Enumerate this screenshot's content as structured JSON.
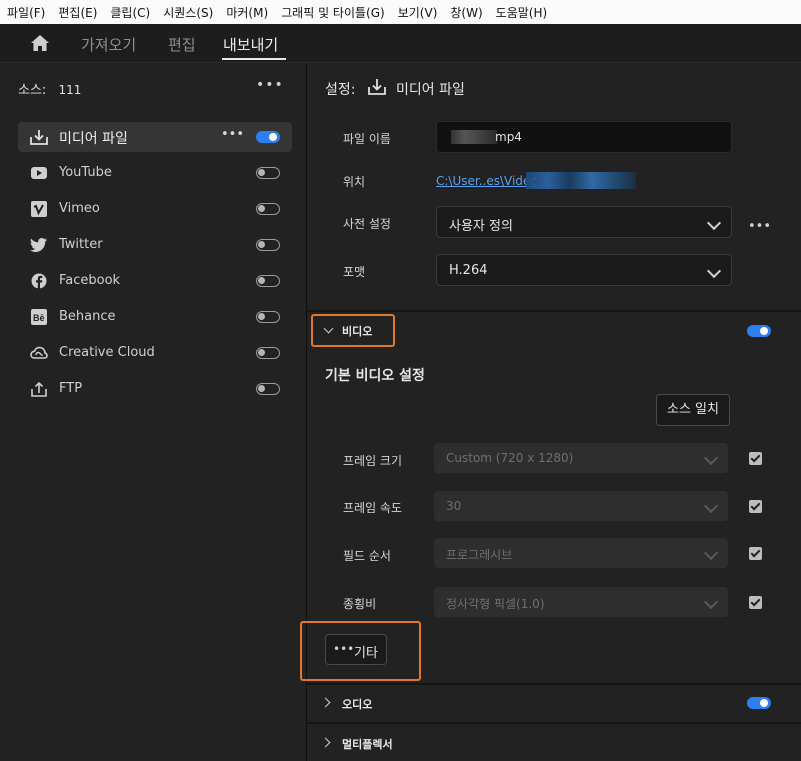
{
  "menubar": [
    "파일(F)",
    "편집(E)",
    "클립(C)",
    "시퀀스(S)",
    "마커(M)",
    "그래픽 및 타이틀(G)",
    "보기(V)",
    "창(W)",
    "도움말(H)"
  ],
  "tabs": {
    "import": "가져오기",
    "edit": "편집",
    "export": "내보내기"
  },
  "source": {
    "label": "소스:",
    "name": "111",
    "more": "•••"
  },
  "destinations": [
    {
      "label": "미디어 파일",
      "icon": "export-file-icon",
      "enabled": true,
      "selected": true,
      "more": "•••"
    },
    {
      "label": "YouTube",
      "icon": "youtube-icon",
      "enabled": false
    },
    {
      "label": "Vimeo",
      "icon": "vimeo-icon",
      "enabled": false
    },
    {
      "label": "Twitter",
      "icon": "twitter-icon",
      "enabled": false
    },
    {
      "label": "Facebook",
      "icon": "facebook-icon",
      "enabled": false
    },
    {
      "label": "Behance",
      "icon": "behance-icon",
      "enabled": false
    },
    {
      "label": "Creative Cloud",
      "icon": "creative-cloud-icon",
      "enabled": false
    },
    {
      "label": "FTP",
      "icon": "ftp-upload-icon",
      "enabled": false
    }
  ],
  "settings": {
    "header": "설정:",
    "target": "미디어 파일",
    "filename_label": "파일 이름",
    "filename_value": "mp4",
    "location_label": "위치",
    "location_value": "C:\\User..es\\Videc",
    "preset_label": "사전 설정",
    "preset_value": "사용자 정의",
    "preset_more": "•••",
    "format_label": "포맷",
    "format_value": "H.264"
  },
  "video": {
    "section_label": "비디오",
    "enabled": true,
    "basic_title": "기본 비디오 설정",
    "match_source": "소스 일치",
    "rows": [
      {
        "label": "프레임 크기",
        "value": "Custom (720 x 1280)",
        "checked": true
      },
      {
        "label": "프레임 속도",
        "value": "30",
        "checked": true
      },
      {
        "label": "필드 순서",
        "value": "프로그레시브",
        "checked": true
      },
      {
        "label": "종횡비",
        "value": "정사각형 픽셀(1.0)",
        "checked": true
      }
    ],
    "more_label": "기타",
    "more_dots": "•••"
  },
  "audio": {
    "section_label": "오디오",
    "enabled": true
  },
  "multiplexer": {
    "section_label": "멀티플렉서"
  },
  "colors": {
    "accent": "#2d7ef0",
    "highlight": "#e0782c",
    "link": "#5aa2ef"
  }
}
